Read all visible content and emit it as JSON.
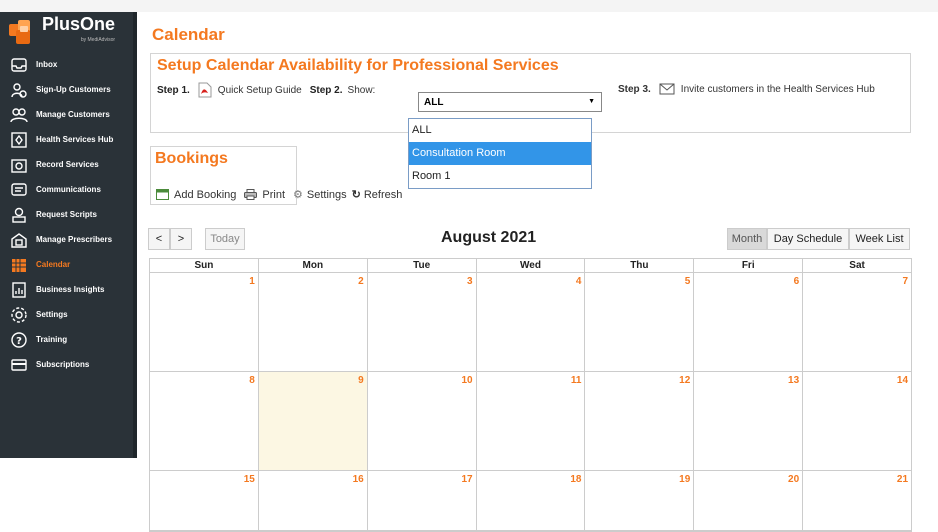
{
  "app": {
    "name": "PlusOne",
    "sub": "by MediAdvisor"
  },
  "sidebar": {
    "items": [
      {
        "label": "Inbox",
        "icon": "inbox-icon"
      },
      {
        "label": "Sign-Up Customers",
        "icon": "signup-icon"
      },
      {
        "label": "Manage Customers",
        "icon": "customers-icon"
      },
      {
        "label": "Health Services Hub",
        "icon": "hub-icon"
      },
      {
        "label": "Record Services",
        "icon": "record-icon"
      },
      {
        "label": "Communications",
        "icon": "communications-icon"
      },
      {
        "label": "Request Scripts",
        "icon": "scripts-icon"
      },
      {
        "label": "Manage Prescribers",
        "icon": "prescribers-icon"
      },
      {
        "label": "Calendar",
        "icon": "calendar-icon",
        "active": true
      },
      {
        "label": "Business Insights",
        "icon": "insights-icon"
      },
      {
        "label": "Settings",
        "icon": "settings-icon"
      },
      {
        "label": "Training",
        "icon": "training-icon"
      },
      {
        "label": "Subscriptions",
        "icon": "subscriptions-icon"
      }
    ]
  },
  "page": {
    "title": "Calendar"
  },
  "setup": {
    "title": "Setup Calendar Availability for Professional Services",
    "step1_label": "Step 1.",
    "step1_link": "Quick Setup Guide",
    "step2_label": "Step 2.",
    "show_label": "Show:",
    "selected": "ALL",
    "options": [
      "ALL",
      "Consultation Room",
      "Room 1"
    ],
    "step3_label": "Step 3.",
    "step3_link": "Invite customers in the Health Services Hub"
  },
  "bookings": {
    "title": "Bookings",
    "add": "Add Booking",
    "print": "Print",
    "settings": "Settings",
    "refresh": "Refresh"
  },
  "calendar": {
    "prev": "<",
    "next": ">",
    "today": "Today",
    "month_title": "August 2021",
    "views": [
      "Month",
      "Day Schedule",
      "Week List"
    ],
    "active_view": "Month",
    "days": [
      "Sun",
      "Mon",
      "Tue",
      "Wed",
      "Thu",
      "Fri",
      "Sat"
    ],
    "weeks": [
      [
        "1",
        "2",
        "3",
        "4",
        "5",
        "6",
        "7"
      ],
      [
        "8",
        "9",
        "10",
        "11",
        "12",
        "13",
        "14"
      ],
      [
        "15",
        "16",
        "17",
        "18",
        "19",
        "20",
        "21"
      ]
    ],
    "highlighted_date": "9"
  },
  "colors": {
    "accent": "#f47920",
    "sidebar": "#2a3238",
    "selected_option": "#3295e8",
    "today_bg": "#fcf7e3"
  }
}
